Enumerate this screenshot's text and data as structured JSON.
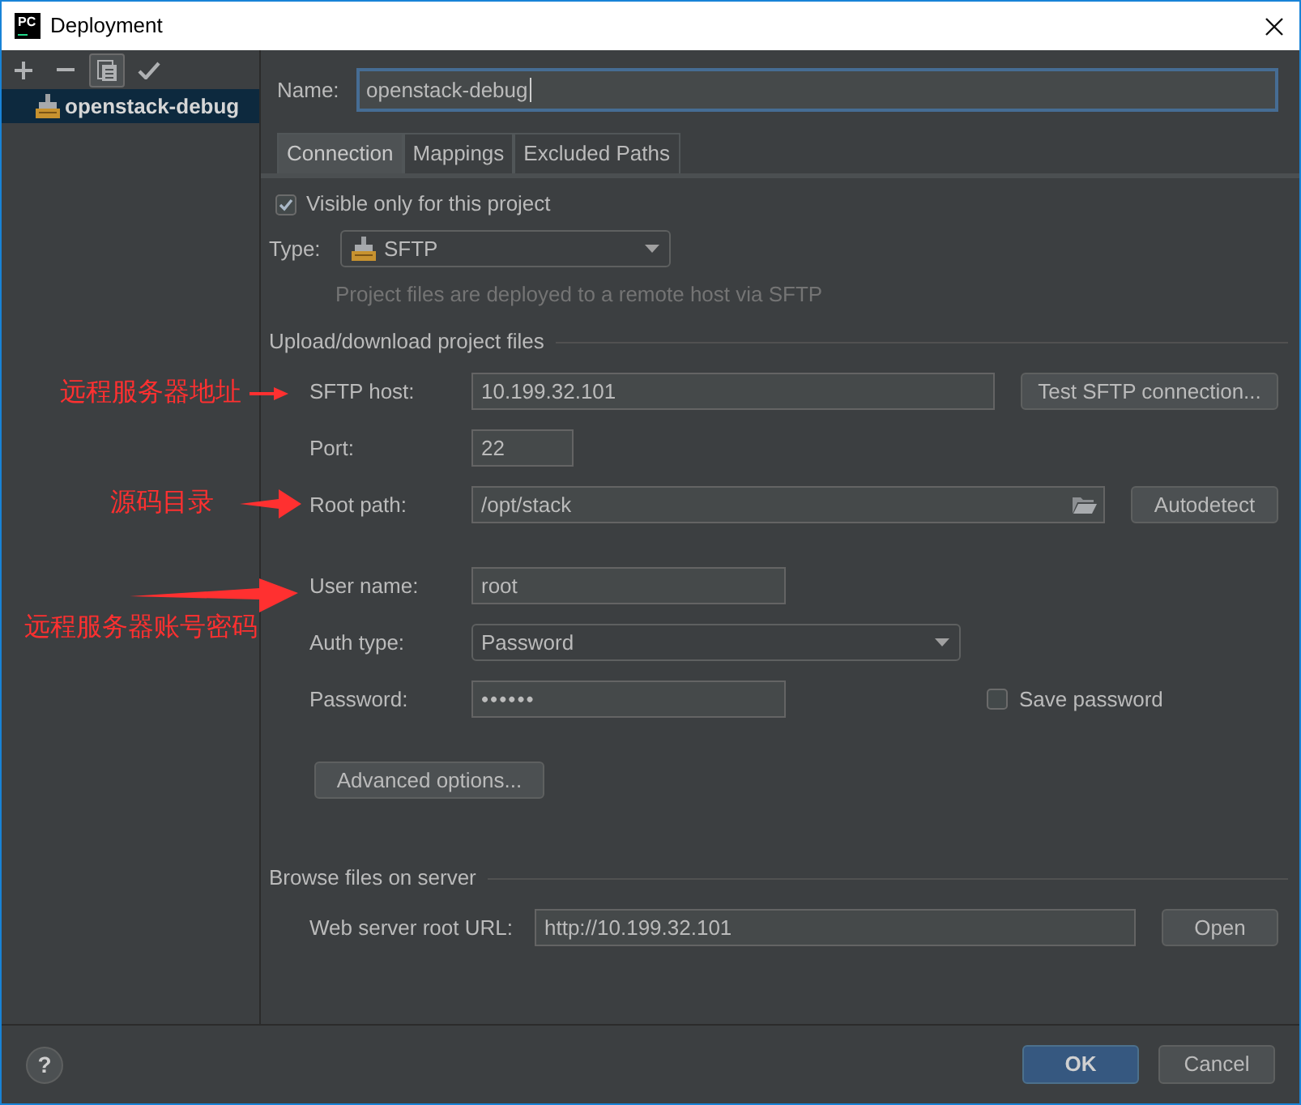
{
  "window": {
    "logo_text": "PC",
    "title": "Deployment"
  },
  "sidebar": {
    "toolbar": [
      {
        "kind": "add",
        "highlighted": false
      },
      {
        "kind": "remove",
        "highlighted": false
      },
      {
        "kind": "copy",
        "highlighted": true
      },
      {
        "kind": "apply",
        "highlighted": false
      }
    ],
    "servers": [
      {
        "name": "openstack-debug",
        "selected": true
      }
    ]
  },
  "name_field": {
    "label": "Name:",
    "value": "openstack-debug",
    "focused": true
  },
  "tabs": [
    {
      "label": "Connection",
      "selected": true
    },
    {
      "label": "Mappings",
      "selected": false
    },
    {
      "label": "Excluded Paths",
      "selected": false
    }
  ],
  "connection": {
    "visible_only": {
      "label": "Visible only for this project",
      "checked": true
    },
    "type": {
      "label": "Type:",
      "value": "SFTP"
    },
    "hint": "Project files are deployed to a remote host via SFTP",
    "upload_section": {
      "title": "Upload/download project files",
      "sftp_host": {
        "label": "SFTP host:",
        "value": "10.199.32.101",
        "button": "Test SFTP connection..."
      },
      "port": {
        "label": "Port:",
        "value": "22"
      },
      "root_path": {
        "label": "Root path:",
        "value": "/opt/stack",
        "button": "Autodetect"
      },
      "user_name": {
        "label": "User name:",
        "value": "root"
      },
      "auth_type": {
        "label": "Auth type:",
        "value": "Password"
      },
      "password": {
        "label": "Password:",
        "value": "••••••"
      },
      "save_password": {
        "label": "Save password",
        "checked": false
      },
      "advanced_button": "Advanced options..."
    },
    "browse_section": {
      "title": "Browse files on server",
      "web_root": {
        "label": "Web server root URL:",
        "value": "http://10.199.32.101",
        "button": "Open"
      }
    }
  },
  "annotations": [
    {
      "text": "远程服务器地址"
    },
    {
      "text": "源码目录"
    },
    {
      "text": "远程服务器账号密码"
    }
  ],
  "help_button": {
    "label": "?"
  },
  "buttons": [
    {
      "label": "OK",
      "default": true
    },
    {
      "label": "Cancel",
      "default": false
    }
  ]
}
